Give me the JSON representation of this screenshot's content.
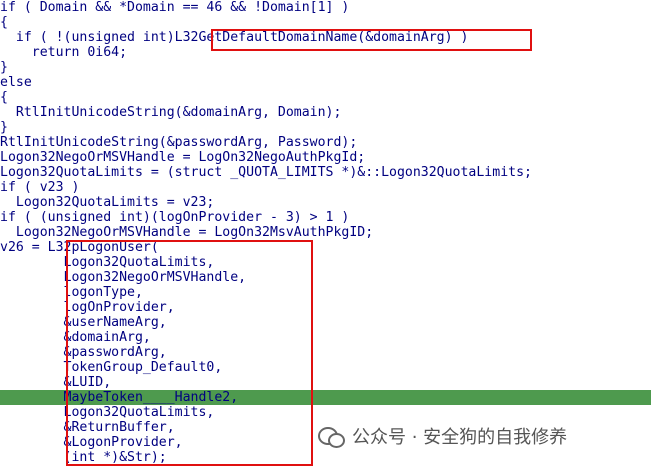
{
  "code_lines": [
    "if ( Domain && *Domain == 46 && !Domain[1] )",
    "{",
    "  if ( !(unsigned int)L32GetDefaultDomainName(&domainArg) )",
    "    return 0i64;",
    "}",
    "else",
    "{",
    "  RtlInitUnicodeString(&domainArg, Domain);",
    "}",
    "RtlInitUnicodeString(&passwordArg, Password);",
    "Logon32NegoOrMSVHandle = LogOn32NegoAuthPkgId;",
    "Logon32QuotaLimits = (struct _QUOTA_LIMITS *)&::Logon32QuotaLimits;",
    "if ( v23 )",
    "  Logon32QuotaLimits = v23;",
    "if ( (unsigned int)(logOnProvider - 3) > 1 )",
    "  Logon32NegoOrMSVHandle = LogOn32MsvAuthPkgID;",
    "v26 = L32pLogonUser(",
    "        Logon32QuotaLimits,",
    "        Logon32NegoOrMSVHandle,",
    "        logonType,",
    "        logOnProvider,",
    "        &userNameArg,",
    "        &domainArg,",
    "        &passwordArg,",
    "        TokenGroup_Default0,",
    "        &LUID,",
    "        MaybeToken____Handle2,",
    "        Logon32QuotaLimits,",
    "        &ReturnBuffer,",
    "        &LogonProvider,",
    "        (int *)&Str);"
  ],
  "watermark": {
    "text": "公众号 · 安全狗的自我修养",
    "icon": "wechat-icon"
  },
  "colors": {
    "highlight_line": "#4e9a4e",
    "annotation_box": "#e01010"
  },
  "highlighted_line": 25
}
